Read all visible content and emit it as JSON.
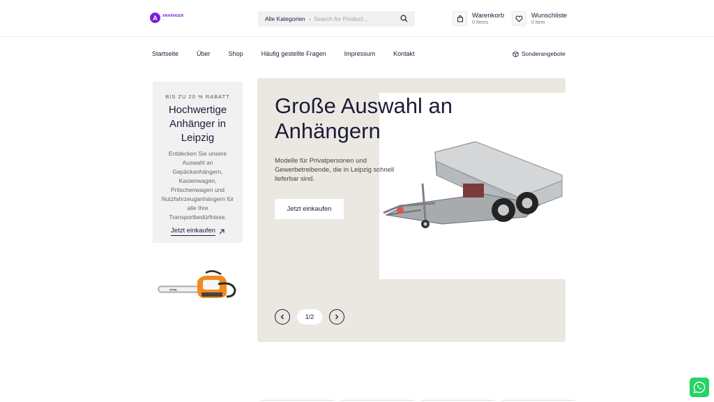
{
  "header": {
    "logo_letter": "A",
    "logo_name": "ANHÄNGER",
    "logo_sub": "•",
    "search": {
      "category_label": "Alle Kategorien",
      "placeholder": "Search for Product..."
    },
    "cart": {
      "title": "Warenkorb",
      "count": "0 Items"
    },
    "wishlist": {
      "title": "Wunschliste",
      "count": "0 Item"
    }
  },
  "nav": {
    "items": [
      "Startseite",
      "Über",
      "Shop",
      "Häufig gestellte Fragen",
      "Impressum",
      "Kontakt"
    ],
    "special": "Sonderangebote"
  },
  "promo": {
    "kicker": "BIS ZU 20 % RABATT",
    "title": "Hochwertige Anhänger in Leipzig",
    "text": "Entdecken Sie unsere Auswahl an Gepäckanhängern, Kastenwagen, Pritschenwagen und Nutzfahrzeuganhängern für alle Ihre Transportbedürfnisse.",
    "link_label": "Jetzt einkaufen"
  },
  "hero": {
    "title": "Große Auswahl an Anhängern",
    "text": "Modelle für Privatpersonen und Gewerbetreibende, die in Leipzig schnell lieferbar sind.",
    "button_label": "Jetzt einkaufen",
    "pager": "1/2"
  },
  "colors": {
    "brand": "#7a1fd6",
    "text": "#1c1b3a",
    "hero_bg": "#ebe8e1",
    "promo_bg": "#f1f1f2",
    "whatsapp": "#25d366"
  },
  "icons": {
    "logo": "logo-badge",
    "search": "search-icon",
    "cart": "cart-icon",
    "wishlist": "heart-icon",
    "special": "box-icon",
    "arrow": "arrow-up-right-icon",
    "prev": "chevron-left-icon",
    "next": "chevron-right-icon",
    "chat": "whatsapp-icon"
  }
}
